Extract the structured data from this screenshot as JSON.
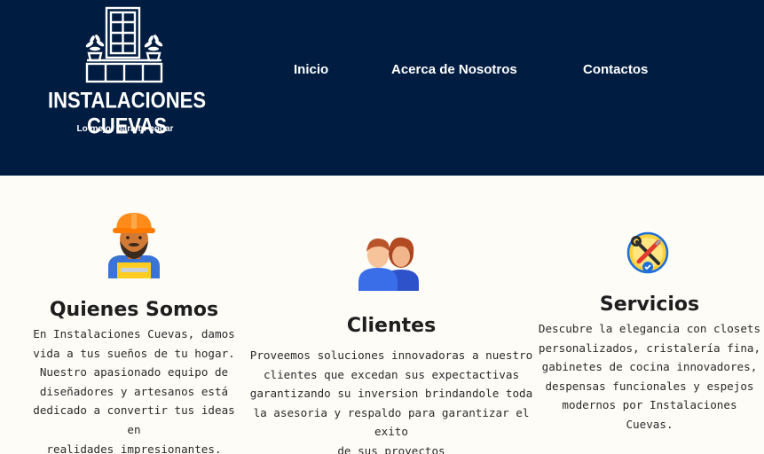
{
  "header": {
    "brand": "INSTALACIONES CUEVAS",
    "tagline": "Lo mejor para tu hogar",
    "logo_icon": "window-cabinet-plants-logo",
    "background": "#001c40"
  },
  "nav": {
    "items": [
      {
        "label": "Inicio"
      },
      {
        "label": "Acerca de Nosotros"
      },
      {
        "label": "Contactos"
      }
    ]
  },
  "cards": [
    {
      "icon": "construction-worker-icon",
      "title": "Quienes Somos",
      "lines": [
        "En Instalaciones Cuevas, damos",
        "vida a tus sueños de tu hogar.",
        "Nuestro apasionado equipo de",
        "diseñadores y artesanos está",
        "dedicado a convertir tus ideas en",
        "realidades impresionantes."
      ]
    },
    {
      "icon": "two-people-icon",
      "title": "Clientes",
      "lines": [
        "Proveemos soluciones innovadoras a nuestro",
        "clientes que excedan sus expectactivas",
        "garantizando su inversion brindandole toda",
        "la asesoria y respaldo para garantizar el exito",
        "de sus proyectos"
      ]
    },
    {
      "icon": "tools-repair-icon",
      "title": "Servicios",
      "lines": [
        "Descubre la elegancia con closets",
        "personalizados, cristalería fina,",
        "gabinetes de cocina innovadores,",
        "despensas funcionales y espejos",
        "modernos por Instalaciones",
        "Cuevas."
      ]
    }
  ]
}
